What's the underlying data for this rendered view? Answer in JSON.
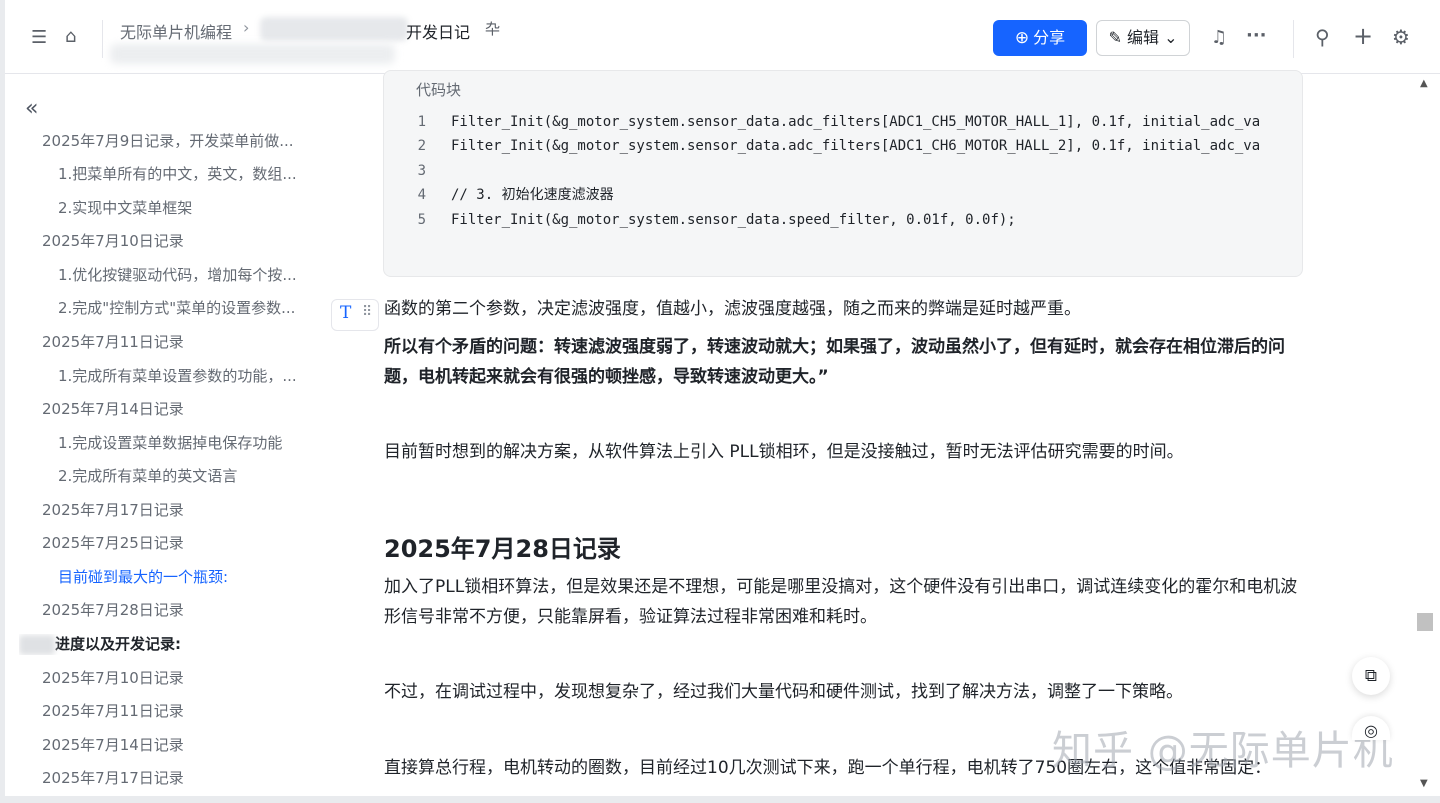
{
  "header": {
    "breadcrumb_root": "无际单片机编程",
    "breadcrumb_sep": "›",
    "doc_title": "开发日记",
    "share_label": "分享",
    "edit_label": "编辑"
  },
  "icons": {
    "toc_toggle": "☰",
    "home": "⌂",
    "pin": "卆",
    "globe": "⊕",
    "pencil": "✎",
    "chevron_down": "⌄",
    "bell": "♫",
    "more": "···",
    "search": "⚲",
    "plus": "+",
    "gear": "⚙",
    "collapse": "«",
    "copy": "⧉",
    "locate": "◎"
  },
  "sidebar": {
    "items": [
      {
        "label": "2025年7月9日记录，开发菜单前做..."
      },
      {
        "label": "1.把菜单所有的中文，英文，数组..."
      },
      {
        "label": "2.实现中文菜单框架"
      },
      {
        "label": "2025年7月10日记录"
      },
      {
        "label": "1.优化按键驱动代码，增加每个按..."
      },
      {
        "label": "2.完成\"控制方式\"菜单的设置参数..."
      },
      {
        "label": "2025年7月11日记录"
      },
      {
        "label": "1.完成所有菜单设置参数的功能，..."
      },
      {
        "label": "2025年7月14日记录"
      },
      {
        "label": "1.完成设置菜单数据掉电保存功能"
      },
      {
        "label": "2.完成所有菜单的英文语言"
      },
      {
        "label": "2025年7月17日记录"
      },
      {
        "label": "2025年7月25日记录"
      },
      {
        "label": "目前碰到最大的一个瓶颈:"
      },
      {
        "label": "2025年7月28日记录"
      },
      {
        "label": "进度以及开发记录:"
      },
      {
        "label": "2025年7月10日记录"
      },
      {
        "label": "2025年7月11日记录"
      },
      {
        "label": "2025年7月14日记录"
      },
      {
        "label": "2025年7月17日记录"
      }
    ]
  },
  "code": {
    "caption": "代码块",
    "lines": [
      {
        "n": "1",
        "text": "Filter_Init(&g_motor_system.sensor_data.adc_filters[ADC1_CH5_MOTOR_HALL_1], 0.1f, initial_adc_va"
      },
      {
        "n": "2",
        "text": "Filter_Init(&g_motor_system.sensor_data.adc_filters[ADC1_CH6_MOTOR_HALL_2], 0.1f, initial_adc_va"
      },
      {
        "n": "3",
        "text": ""
      },
      {
        "n": "4",
        "text": "// 3. 初始化速度滤波器"
      },
      {
        "n": "5",
        "text": "Filter_Init(&g_motor_system.sensor_data.speed_filter, 0.01f, 0.0f);"
      }
    ]
  },
  "content": {
    "p1": "函数的第二个参数，决定滤波强度，值越小，滤波强度越强，随之而来的弊端是延时越严重。",
    "p2": "所以有个矛盾的问题：转速滤波强度弱了，转速波动就大；如果强了，波动虽然小了，但有延时，就会存在相位滞后的问题，电机转起来就会有很强的顿挫感，导致转速波动更大。”",
    "p3": "目前暂时想到的解决方案，从软件算法上引入 PLL锁相环，但是没接触过，暂时无法评估研究需要的时间。",
    "heading": "2025年7月28日记录",
    "p4": "加入了PLL锁相环算法，但是效果还是不理想，可能是哪里没搞对，这个硬件没有引出串口，调试连续变化的霍尔和电机波形信号非常不方便，只能靠屏看，验证算法过程非常困难和耗时。",
    "p5": "不过，在调试过程中，发现想复杂了，经过我们大量代码和硬件测试，找到了解决方法，调整了一下策略。",
    "p6": "直接算总行程，电机转动的圈数，目前经过10几次测试下来，跑一个单行程，电机转了750圈左右，这个值非常固定："
  },
  "block_handle": {
    "type_label": "T",
    "drag": "⠿"
  },
  "watermark": "知乎 @无际单片机",
  "colors": {
    "accent": "#1664ff",
    "text": "#1f2329",
    "muted": "#646a73"
  }
}
